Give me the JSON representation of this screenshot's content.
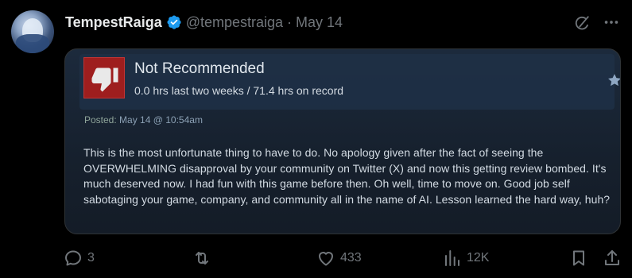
{
  "post": {
    "author_name": "TempestRaiga",
    "handle": "@tempestraiga",
    "separator": "·",
    "date": "May 14"
  },
  "review_card": {
    "verdict": "Not Recommended",
    "hours": "0.0 hrs last two weeks / 71.4 hrs on record",
    "posted_label": "Posted:",
    "posted_date": "May 14 @ 10:54am",
    "text": "This is the most unfortunate thing to have to do. No apology given after the fact of seeing the OVERWHELMING disapproval by your community on Twitter (X) and now this getting review bombed. It's much deserved now. I had fun with this game before then. Oh well, time to move on. Good job self sabotaging your game, company, and community all in the name of AI. Lesson learned the hard way, huh?"
  },
  "actions": {
    "replies": "3",
    "reposts": "",
    "likes": "433",
    "views": "12K"
  },
  "colors": {
    "background": "#000000",
    "verified_blue": "#1d9bf0",
    "thumb_red": "#9e1e1e",
    "muted": "#71767b"
  },
  "icons": [
    "verified-badge-icon",
    "grok-icon",
    "more-icon",
    "thumbs-down-icon",
    "star-icon",
    "reply-icon",
    "repost-icon",
    "like-icon",
    "views-icon",
    "bookmark-icon",
    "share-icon"
  ]
}
